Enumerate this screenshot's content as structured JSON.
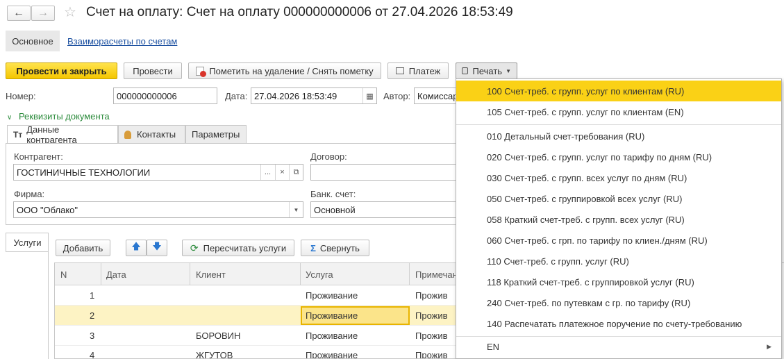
{
  "window": {
    "title": "Счет на оплату: Счет на оплату 000000000006 от 27.04.2026 18:53:49"
  },
  "nav": {
    "main": "Основное",
    "link": "Взаиморасчеты по счетам"
  },
  "toolbar": {
    "post_close": "Провести и закрыть",
    "post": "Провести",
    "mark_delete": "Пометить на удаление / Снять пометку",
    "payment": "Платеж",
    "print": "Печать"
  },
  "header": {
    "number_label": "Номер:",
    "number_value": "000000000006",
    "date_label": "Дата:",
    "date_value": "27.04.2026 18:53:49",
    "author_label": "Автор:",
    "author_value": "Комиссар"
  },
  "requisites": {
    "toggle": "Реквизиты документа",
    "tabs": [
      "Данные контрагента",
      "Контакты",
      "Параметры"
    ],
    "contractor_label": "Контрагент:",
    "contractor_value": "ГОСТИНИЧНЫЕ ТЕХНОЛОГИИ",
    "contract_label": "Договор:",
    "contract_value": "",
    "firm_label": "Фирма:",
    "firm_value": "ООО \"Облако\"",
    "bank_label": "Банк. счет:",
    "bank_value": "Основной",
    "ellipsis": "...",
    "clear": "×"
  },
  "services": {
    "tab": "Услуги",
    "add": "Добавить",
    "recalc": "Пересчитать услуги",
    "collapse": "Свернуть",
    "columns": [
      "N",
      "Дата",
      "Клиент",
      "Услуга",
      "Примечан"
    ],
    "rows": [
      {
        "n": "1",
        "date": "",
        "client": "",
        "service": "Проживание",
        "note": "Прожив"
      },
      {
        "n": "2",
        "date": "",
        "client": "",
        "service": "Проживание",
        "note": "Прожив"
      },
      {
        "n": "3",
        "date": "",
        "client": "БОРОВИН",
        "service": "Проживание",
        "note": "Прожив"
      },
      {
        "n": "4",
        "date": "",
        "client": "ЖГУТОВ",
        "service": "Проживание",
        "note": "Прожив"
      }
    ]
  },
  "print_menu": {
    "items": [
      "100 Счет-треб. с групп. услуг по клиентам (RU)",
      "105 Счет-треб. с групп. услуг по клиентам (EN)",
      "010 Детальный счет-требования (RU)",
      "020 Счет-треб. с групп. услуг по тарифу по дням (RU)",
      "030 Счет-треб. с групп. всех услуг по дням (RU)",
      "050 Счет-треб. с группировкой всех услуг (RU)",
      "058 Краткий счет-треб. с групп. всех услуг (RU)",
      "060 Счет-треб. с грп. по тарифу по клиен./дням (RU)",
      "110 Счет-треб. с групп. услуг (RU)",
      "118 Краткий счет-треб. с группировкой услуг (RU)",
      "240 Счет-треб. по путевкам с гр. по тарифу (RU)",
      "140 Распечатать платежное поручение по счету-требованию"
    ],
    "submenu": "EN"
  },
  "colors": {
    "accent": "#f4c600",
    "highlight": "#fad116",
    "link": "#1a4fa0",
    "selected_row": "#fdf3c4"
  }
}
